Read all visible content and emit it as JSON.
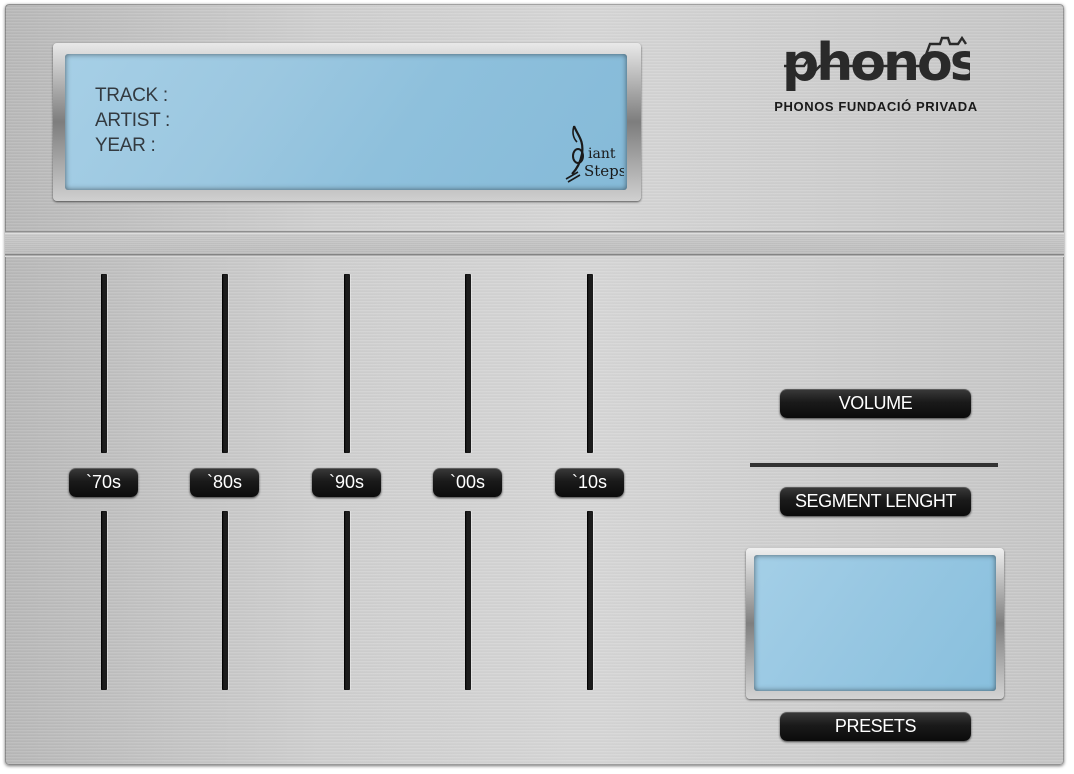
{
  "display": {
    "track_label": "TRACK :",
    "artist_label": "ARTIST :",
    "year_label": "YEAR :",
    "logo_text_line1": "iant",
    "logo_text_line2": "Steps"
  },
  "brand": {
    "name": "phonos",
    "subtitle": "PHONOS FUNDACIÓ PRIVADA"
  },
  "sliders": [
    {
      "label": "`70s",
      "value": 0.5
    },
    {
      "label": "`80s",
      "value": 0.5
    },
    {
      "label": "`90s",
      "value": 0.5
    },
    {
      "label": "`00s",
      "value": 0.5
    },
    {
      "label": "`10s",
      "value": 0.5
    }
  ],
  "controls": {
    "volume_label": "VOLUME",
    "segment_label": "SEGMENT LENGHT",
    "presets_label": "PRESETS"
  },
  "colors": {
    "lcd": "#9bc7e0",
    "panel": "#cfcfcf",
    "knob": "#1a1a1a"
  }
}
